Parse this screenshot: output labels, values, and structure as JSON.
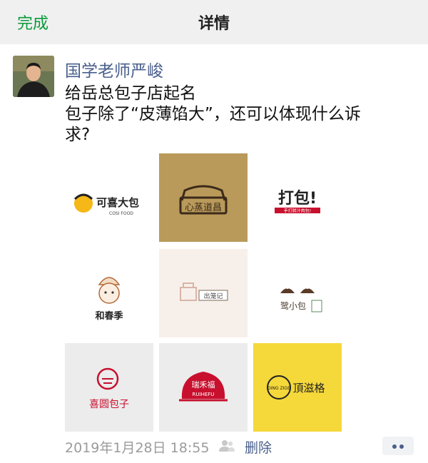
{
  "nav": {
    "done_label": "完成",
    "title": "详情"
  },
  "post": {
    "author": "国学老师严峻",
    "lines": [
      "给岳总包子店起名",
      "包子除了“皮薄馅大”，还可以体现什么诉",
      "求?"
    ],
    "timestamp": "2019年1月28日 18:55",
    "delete_label": "删除"
  },
  "images": [
    {
      "name": "可喜大包",
      "sub": "COSI FOOD"
    },
    {
      "name": "心蒸道昌"
    },
    {
      "name": "打包!",
      "sub": "手打鲜汁肉包!"
    },
    {
      "name": "和春季"
    },
    {
      "name": "出笼记"
    },
    {
      "name": "鹭小包"
    },
    {
      "name": "喜圆包子"
    },
    {
      "name": "瑞禾福",
      "sub": "RUIHEFU"
    },
    {
      "name": "頂滋格",
      "sub": "DING ZIGE"
    }
  ],
  "colors": {
    "accent_green": "#0a9a3b",
    "link_blue": "#4a5f8c",
    "brand_red": "#c8102e",
    "gold": "#b99a5a",
    "yellow": "#f5d83a"
  },
  "icons": {
    "likes": "people-icon",
    "more": "more-dots-icon"
  }
}
